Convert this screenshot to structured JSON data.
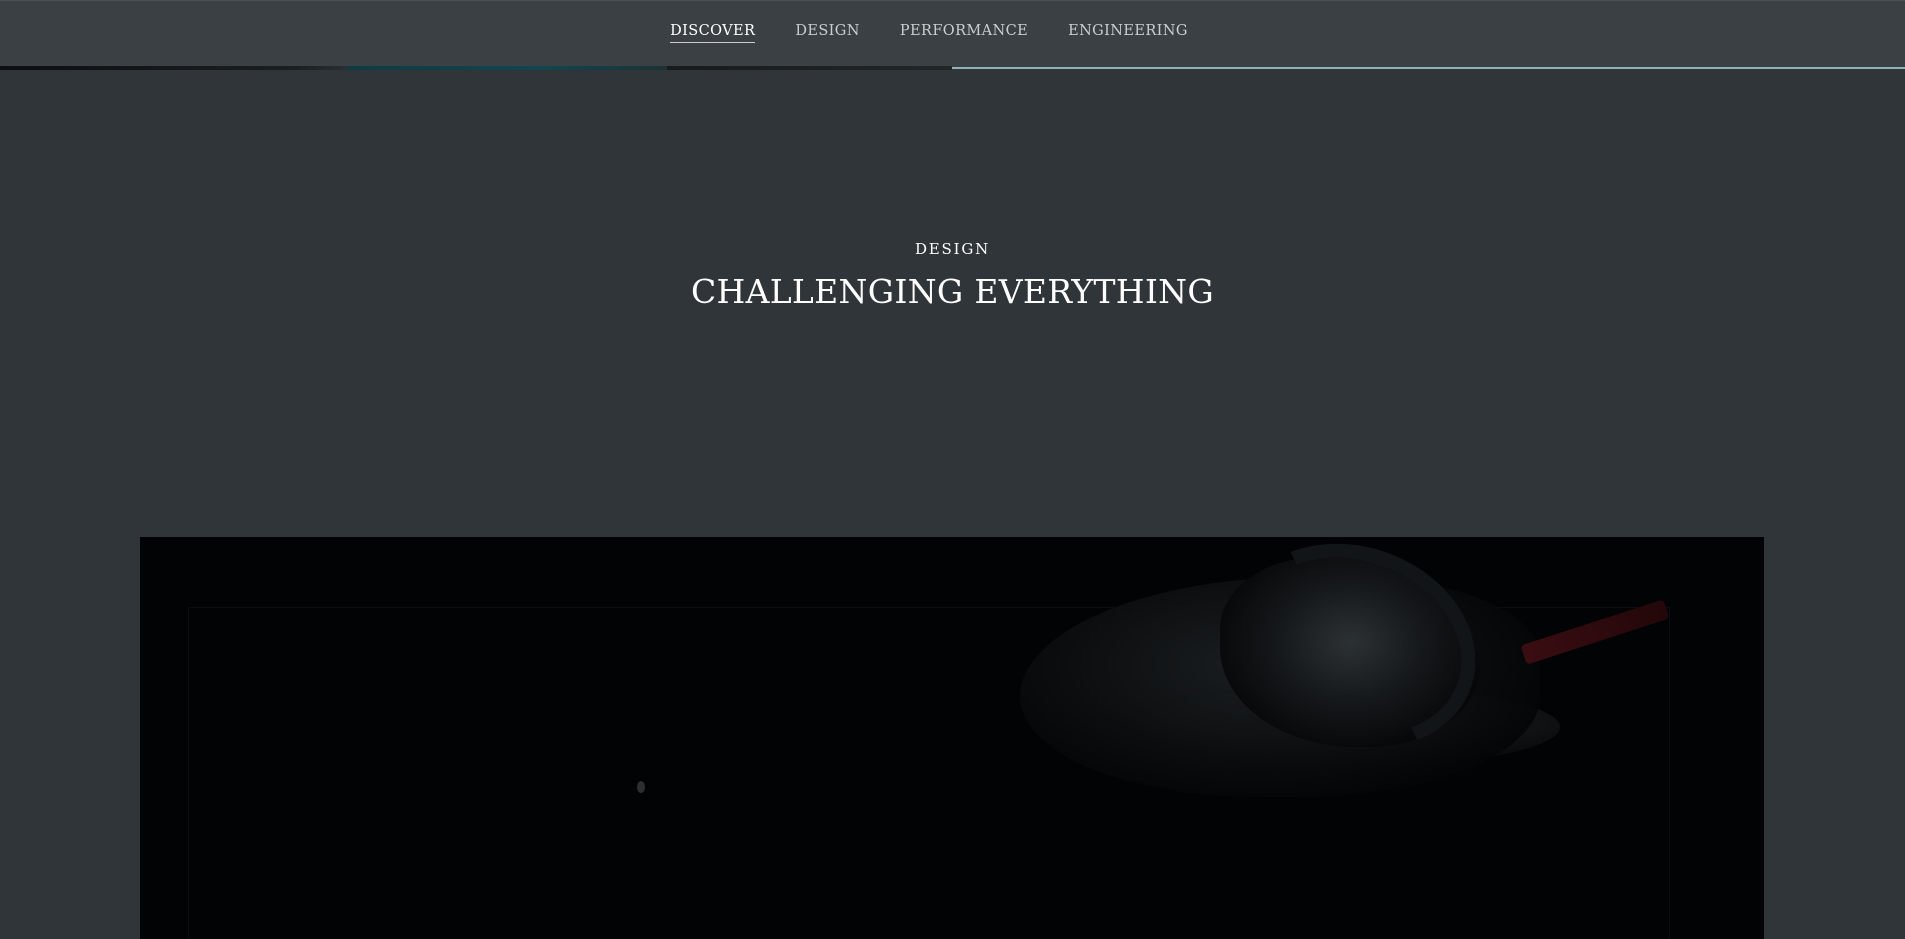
{
  "nav": {
    "items": [
      {
        "label": "DISCOVER",
        "active": true
      },
      {
        "label": "DESIGN",
        "active": false
      },
      {
        "label": "PERFORMANCE",
        "active": false
      },
      {
        "label": "ENGINEERING",
        "active": false
      }
    ]
  },
  "hero": {
    "eyebrow": "DESIGN",
    "headline": "CHALLENGING EVERYTHING"
  },
  "colors": {
    "page_background": "#2f3538",
    "topbar_background": "#3a4043",
    "progress_accent": "#8fb1b8",
    "media_background": "#020304",
    "car_accent": "#3a0d12"
  }
}
